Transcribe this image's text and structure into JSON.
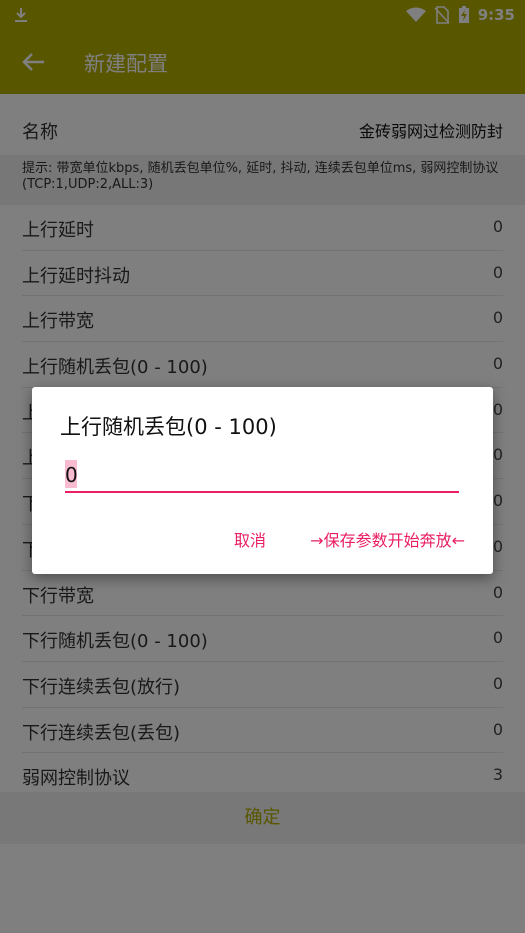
{
  "status_bar": {
    "time": "9:35",
    "icons": [
      "download-icon",
      "wifi-icon",
      "no-sim-icon",
      "battery-charging-icon"
    ]
  },
  "app_bar": {
    "title": "新建配置",
    "back_icon": "arrow-left-icon"
  },
  "name_row": {
    "label": "名称",
    "value": "金砖弱网过检测防封"
  },
  "hint": "提示: 带宽单位kbps, 随机丢包单位%, 延时, 抖动, 连续丢包单位ms, 弱网控制协议(TCP:1,UDP:2,ALL:3)",
  "settings": [
    {
      "label": "上行延时",
      "value": "0"
    },
    {
      "label": "上行延时抖动",
      "value": "0"
    },
    {
      "label": "上行带宽",
      "value": "0"
    },
    {
      "label": "上行随机丢包(0 - 100)",
      "value": "0"
    },
    {
      "label": "上",
      "value": "0"
    },
    {
      "label": "上",
      "value": "0"
    },
    {
      "label": "下",
      "value": "0"
    },
    {
      "label": "下",
      "value": "0"
    },
    {
      "label": "下行带宽",
      "value": "0"
    },
    {
      "label": "下行随机丢包(0 - 100)",
      "value": "0"
    },
    {
      "label": "下行连续丢包(放行)",
      "value": "0"
    },
    {
      "label": "下行连续丢包(丢包)",
      "value": "0"
    },
    {
      "label": "弱网控制协议",
      "value": "3"
    }
  ],
  "confirm_label": "确定",
  "dialog": {
    "title": "上行随机丢包(0 - 100)",
    "input_value": "0",
    "cancel_label": "取消",
    "save_label": "→保存参数开始奔放←"
  },
  "colors": {
    "accent": "#e91e63",
    "appbar": "#b3ad00"
  }
}
